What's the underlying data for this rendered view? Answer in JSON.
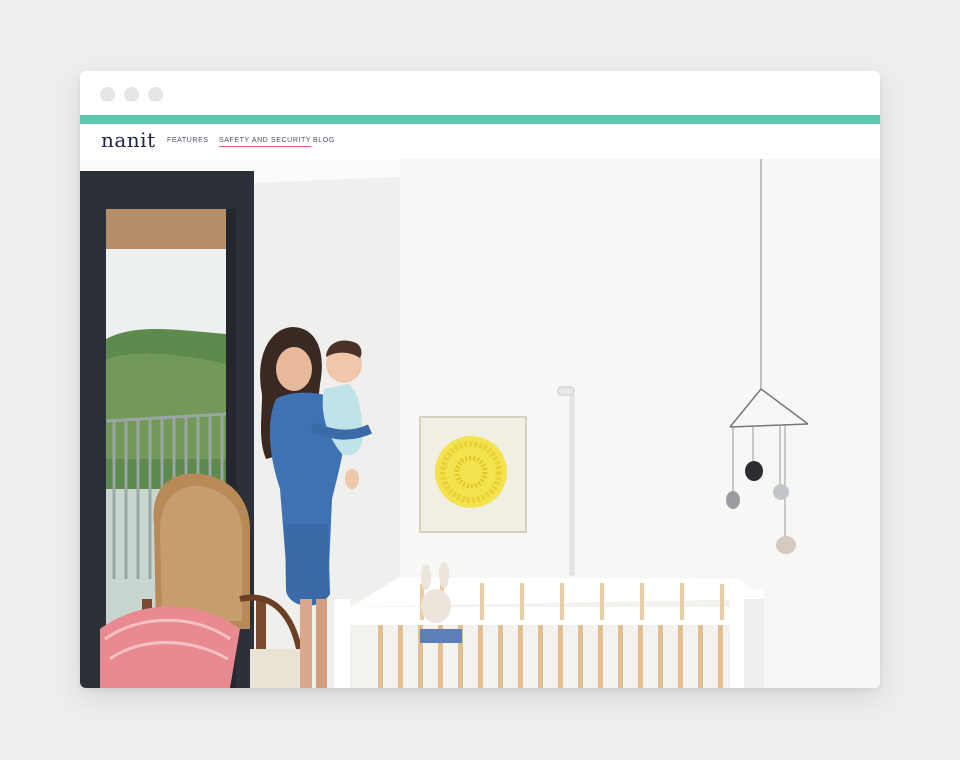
{
  "window": {
    "controls": [
      "window-dot",
      "window-dot",
      "window-dot"
    ]
  },
  "colors": {
    "accent_bar": "#5cc8ac",
    "active_underline": "#e0607a",
    "logo": "#1f2345",
    "page_background": "#eeeeee"
  },
  "header": {
    "logo": "nanit",
    "nav": [
      {
        "label": "FEATURES",
        "active": false
      },
      {
        "label": "SAFETY AND SECURITY",
        "active": true
      },
      {
        "label": "BLOG",
        "active": false
      }
    ]
  }
}
